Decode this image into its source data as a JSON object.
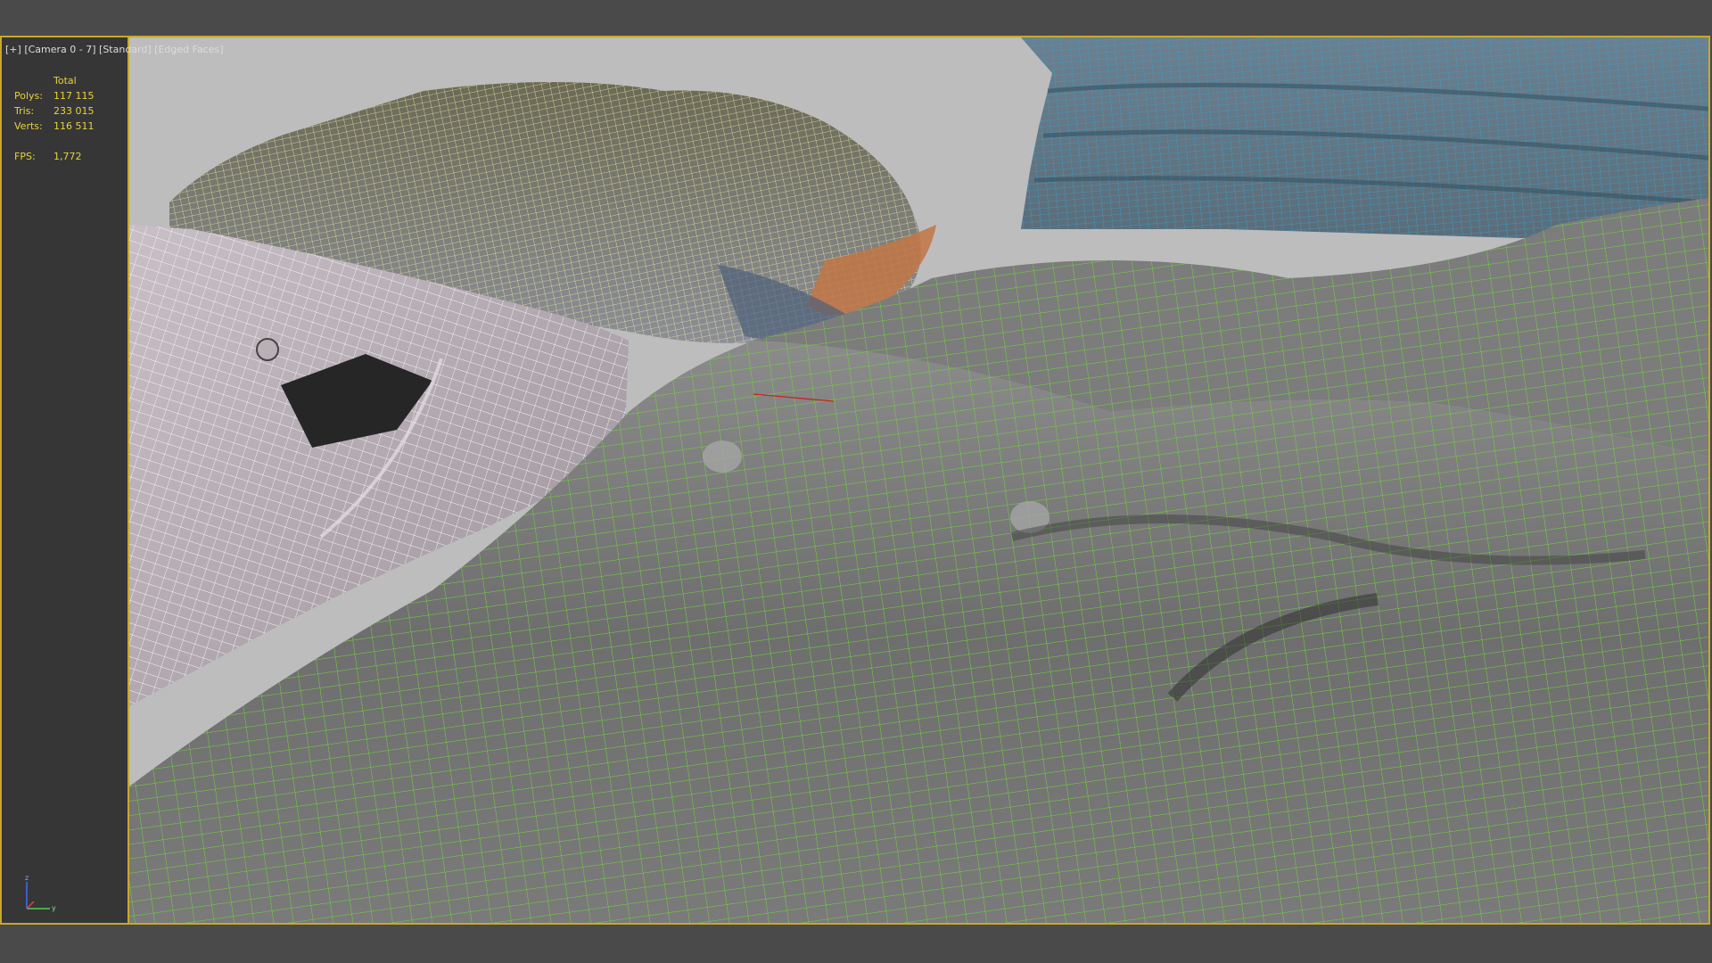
{
  "viewport": {
    "labels": [
      "[+]",
      "[Camera 0 - 7]",
      "[Standard]",
      "[Edged Faces]"
    ]
  },
  "stats": {
    "header": "Total",
    "rows": [
      {
        "key": "Polys:",
        "value": "117 115"
      },
      {
        "key": "Tris:",
        "value": "233 015"
      },
      {
        "key": "Verts:",
        "value": "116 511"
      }
    ],
    "fps": {
      "key": "FPS:",
      "value": "1,772"
    }
  },
  "gizmo": {
    "x": "x",
    "y": "y",
    "z": "z"
  },
  "colors": {
    "frame": "#c8a82c",
    "stats_text": "#e8d23a",
    "wire_green": "#6fd63a",
    "wire_yellow": "#efe0a0",
    "wire_blue": "#3aa0c8",
    "wire_white": "#f2f2f2"
  },
  "objects": [
    "green-cloth-mesh",
    "gray-denim-mesh",
    "yellow-folded-pile-mesh",
    "blue-folded-pile-mesh"
  ]
}
